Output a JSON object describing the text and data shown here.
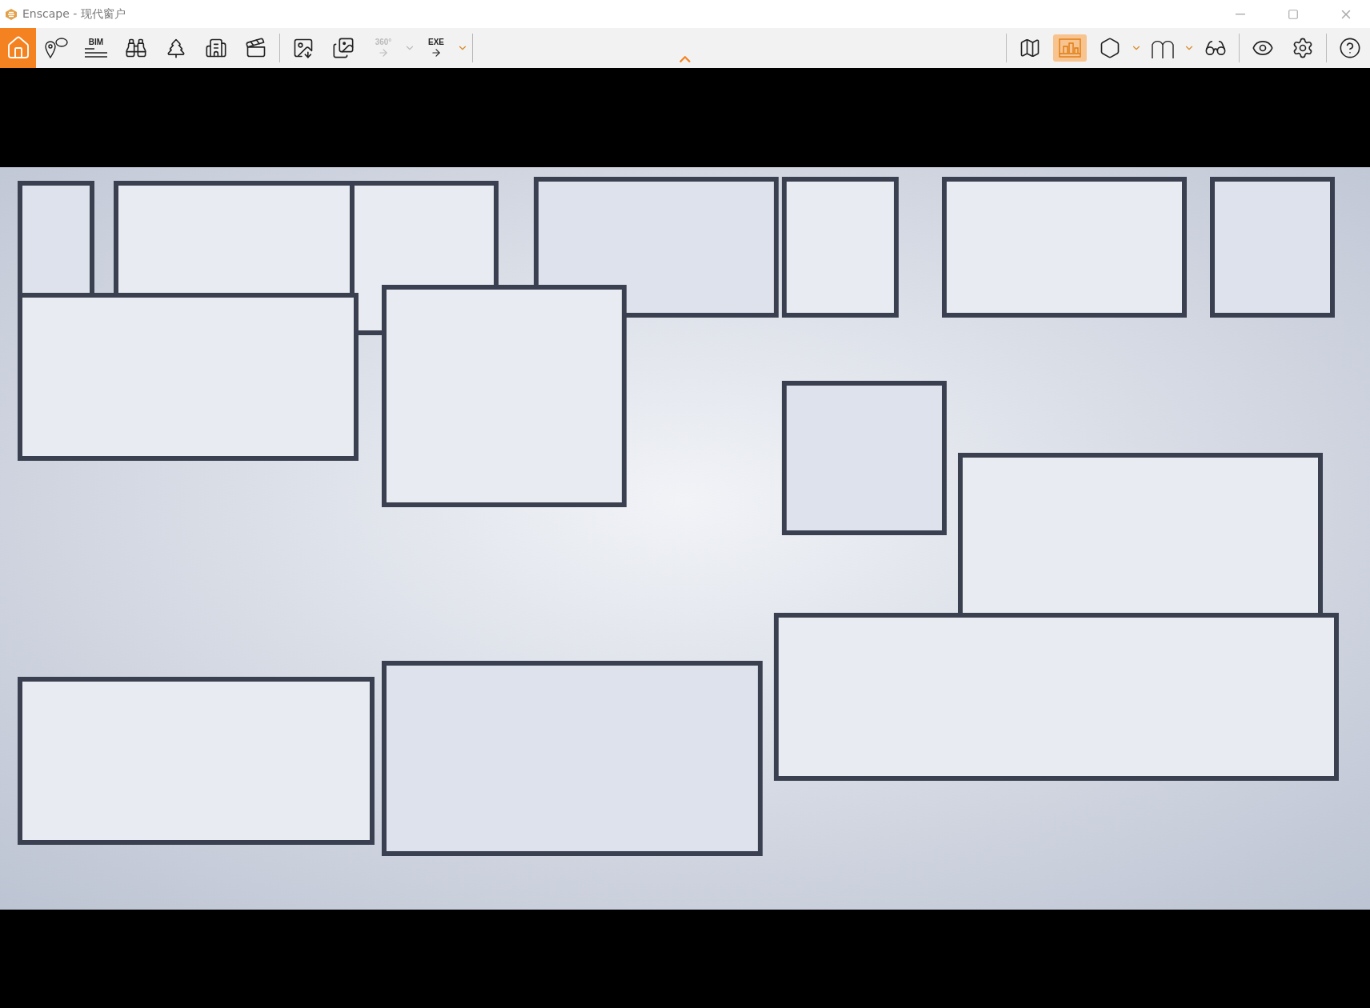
{
  "window": {
    "title": "Enscape - 现代窗户"
  },
  "toolbar": {
    "left": [
      {
        "kind": "home",
        "selected": true,
        "disabled": false
      },
      {
        "kind": "comment",
        "selected": false,
        "disabled": false
      },
      {
        "kind": "bim",
        "text": "BIM",
        "selected": false,
        "disabled": false
      },
      {
        "kind": "binoculars",
        "selected": false,
        "disabled": false
      },
      {
        "kind": "asset",
        "selected": false,
        "disabled": false
      },
      {
        "kind": "buildings",
        "selected": false,
        "disabled": false
      },
      {
        "kind": "video",
        "selected": false,
        "disabled": false
      },
      {
        "kind": "separator"
      },
      {
        "kind": "image-export",
        "selected": false,
        "disabled": false
      },
      {
        "kind": "batch-export",
        "selected": false,
        "disabled": false
      },
      {
        "kind": "panorama",
        "text": "360°",
        "selected": false,
        "disabled": true,
        "dropdown": true
      },
      {
        "kind": "exe",
        "text": "EXE",
        "selected": false,
        "disabled": false,
        "dropdown": true
      },
      {
        "kind": "separator"
      }
    ],
    "right": [
      {
        "kind": "separator"
      },
      {
        "kind": "map",
        "selected": false,
        "disabled": false
      },
      {
        "kind": "render-window",
        "selected": true,
        "disabled": false
      },
      {
        "kind": "section",
        "selected": false,
        "disabled": false,
        "dropdown": true
      },
      {
        "kind": "ghost",
        "selected": false,
        "disabled": false,
        "dropdown": true
      },
      {
        "kind": "vr",
        "selected": false,
        "disabled": false
      },
      {
        "kind": "separator"
      },
      {
        "kind": "eye",
        "selected": false,
        "disabled": false
      },
      {
        "kind": "settings",
        "selected": false,
        "disabled": false
      },
      {
        "kind": "separator"
      },
      {
        "kind": "help",
        "selected": false,
        "disabled": false
      }
    ]
  }
}
